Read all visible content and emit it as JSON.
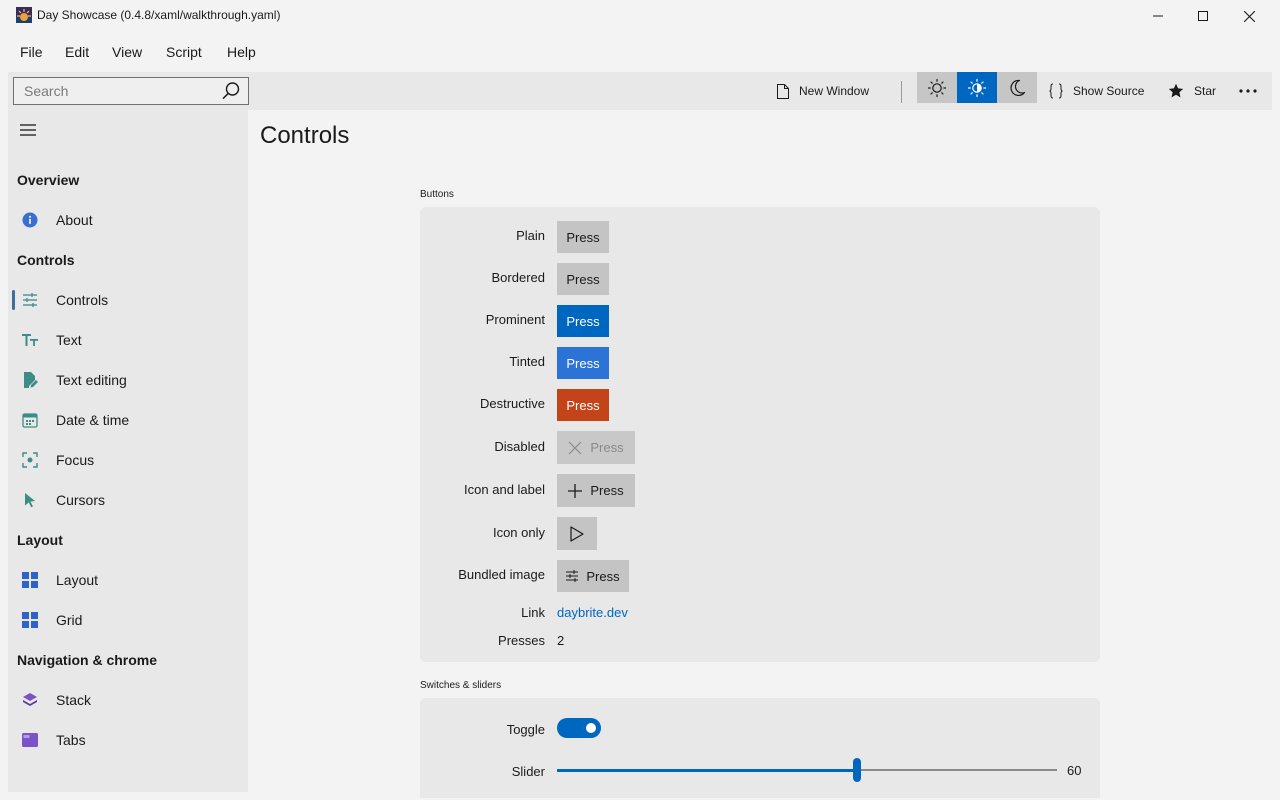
{
  "window": {
    "title": "Day Showcase (0.4.8/xaml/walkthrough.yaml)"
  },
  "menu": {
    "items": [
      "File",
      "Edit",
      "View",
      "Script",
      "Help"
    ]
  },
  "toolbar": {
    "search_placeholder": "Search",
    "new_window_label": "New Window",
    "show_source_label": "Show Source",
    "star_label": "Star",
    "selected_theme": "auto",
    "accent_color": "#0067c0"
  },
  "sidebar": {
    "sections": [
      {
        "title": "Overview",
        "items": [
          {
            "label": "About",
            "icon": "info-icon"
          }
        ]
      },
      {
        "title": "Controls",
        "items": [
          {
            "label": "Controls",
            "icon": "sliders-icon",
            "active": true
          },
          {
            "label": "Text",
            "icon": "text-size-icon"
          },
          {
            "label": "Text editing",
            "icon": "document-edit-icon"
          },
          {
            "label": "Date & time",
            "icon": "calendar-icon"
          },
          {
            "label": "Focus",
            "icon": "focus-icon"
          },
          {
            "label": "Cursors",
            "icon": "cursor-icon"
          }
        ]
      },
      {
        "title": "Layout",
        "items": [
          {
            "label": "Layout",
            "icon": "layout-grid-icon"
          },
          {
            "label": "Grid",
            "icon": "grid-icon"
          }
        ]
      },
      {
        "title": "Navigation & chrome",
        "items": [
          {
            "label": "Stack",
            "icon": "stack-icon"
          },
          {
            "label": "Tabs",
            "icon": "tabs-icon"
          }
        ]
      }
    ]
  },
  "page": {
    "title": "Controls",
    "buttons_group": {
      "label": "Buttons",
      "rows": {
        "plain": {
          "label": "Plain",
          "button": "Press"
        },
        "bordered": {
          "label": "Bordered",
          "button": "Press"
        },
        "prominent": {
          "label": "Prominent",
          "button": "Press"
        },
        "tinted": {
          "label": "Tinted",
          "button": "Press"
        },
        "destructive": {
          "label": "Destructive",
          "button": "Press"
        },
        "disabled": {
          "label": "Disabled",
          "button": "Press"
        },
        "icon_and_label": {
          "label": "Icon and label",
          "button": "Press"
        },
        "icon_only": {
          "label": "Icon only"
        },
        "bundled_image": {
          "label": "Bundled image",
          "button": "Press"
        },
        "link": {
          "label": "Link",
          "text": "daybrite.dev"
        },
        "presses": {
          "label": "Presses",
          "value": "2"
        }
      }
    },
    "switches_group": {
      "label": "Switches & sliders",
      "toggle": {
        "label": "Toggle",
        "on": true
      },
      "slider": {
        "label": "Slider",
        "value": "60",
        "min": 0,
        "max": 100
      }
    }
  }
}
